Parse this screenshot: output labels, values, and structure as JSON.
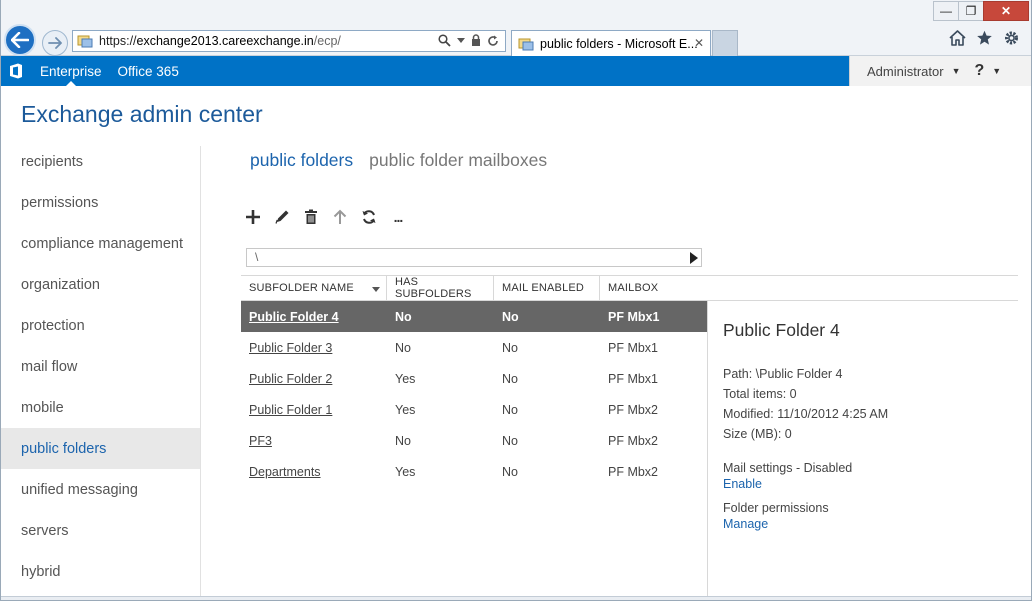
{
  "browser": {
    "url_prefix": "https://",
    "url_host": "exchange2013.careexchange.in",
    "url_path": "/ecp/",
    "tab_title": "public folders - Microsoft E...",
    "tab_close": "✕"
  },
  "window_controls": {
    "minimize": "—",
    "restore": "❐",
    "close": "✕"
  },
  "topbar": {
    "tabs": [
      "Enterprise",
      "Office 365"
    ],
    "user": "Administrator",
    "help": "?"
  },
  "app_title": "Exchange admin center",
  "nav": {
    "items": [
      "recipients",
      "permissions",
      "compliance management",
      "organization",
      "protection",
      "mail flow",
      "mobile",
      "public folders",
      "unified messaging",
      "servers",
      "hybrid"
    ],
    "selected": "public folders"
  },
  "subtabs": [
    "public folders",
    "public folder mailboxes"
  ],
  "toolbar": {
    "icons": [
      "add-icon",
      "edit-icon",
      "delete-icon",
      "move-up-icon",
      "refresh-icon",
      "more-icon"
    ],
    "more_label": "..."
  },
  "path": "\\",
  "grid": {
    "headers": [
      "SUBFOLDER NAME",
      "HAS SUBFOLDERS",
      "MAIL ENABLED",
      "MAILBOX"
    ],
    "rows": [
      {
        "name": "Public Folder 4",
        "has_subfolders": "No",
        "mail_enabled": "No",
        "mailbox": "PF Mbx1"
      },
      {
        "name": "Public Folder 3",
        "has_subfolders": "No",
        "mail_enabled": "No",
        "mailbox": "PF Mbx1"
      },
      {
        "name": "Public Folder 2",
        "has_subfolders": "Yes",
        "mail_enabled": "No",
        "mailbox": "PF Mbx1"
      },
      {
        "name": "Public Folder 1",
        "has_subfolders": "Yes",
        "mail_enabled": "No",
        "mailbox": "PF Mbx2"
      },
      {
        "name": "PF3",
        "has_subfolders": "No",
        "mail_enabled": "No",
        "mailbox": "PF Mbx2"
      },
      {
        "name": "Departments",
        "has_subfolders": "Yes",
        "mail_enabled": "No",
        "mailbox": "PF Mbx2"
      }
    ],
    "selected_index": 0
  },
  "details": {
    "title": "Public Folder 4",
    "path": "Path: \\Public Folder 4",
    "total_items": "Total items: 0",
    "modified": "Modified: 11/10/2012 4:25 AM",
    "size": "Size (MB): 0",
    "mail_settings": "Mail settings - Disabled",
    "enable_link": "Enable",
    "folder_permissions": "Folder permissions",
    "manage_link": "Manage"
  },
  "colors": {
    "accent": "#0072c6",
    "title_blue": "#1c5a9a",
    "link_blue": "#1c64ad",
    "selected_row": "#666666",
    "close_button": "#c7483b"
  }
}
